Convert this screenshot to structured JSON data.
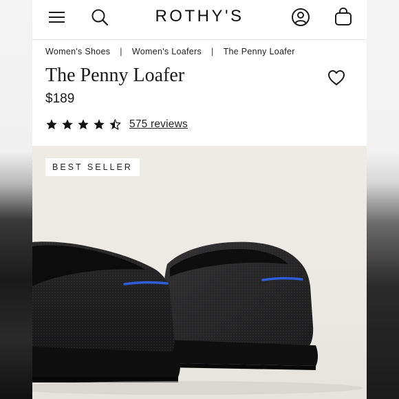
{
  "header": {
    "logo": "ROTHY'S",
    "menu_icon": "menu-icon",
    "search_icon": "search-icon",
    "account_icon": "account-icon",
    "bag_icon": "shopping-bag-icon"
  },
  "breadcrumb": {
    "items": [
      "Women's Shoes",
      "Women's Loafers",
      "The Penny Loafer"
    ],
    "separator": "|"
  },
  "product": {
    "title": "The Penny Loafer",
    "price": "$189",
    "rating": 4.5,
    "reviews_label": "575 reviews",
    "wishlist_icon": "heart-icon",
    "badge": "BEST SELLER",
    "image_subject": "pair of black knit penny loafers",
    "accent_color": "#2f5fd8"
  }
}
